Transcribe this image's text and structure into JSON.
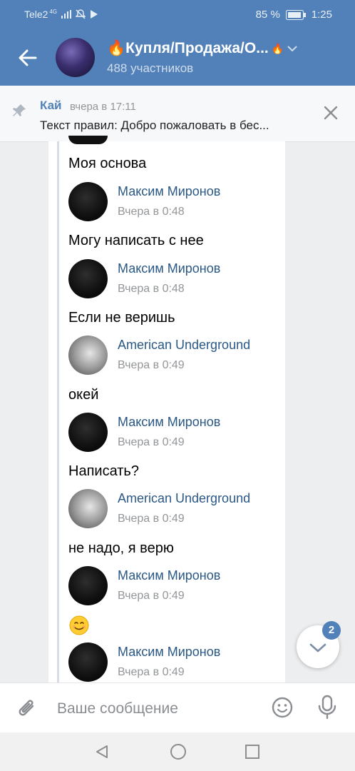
{
  "status_bar": {
    "carrier": "Tele2",
    "network": "4G",
    "battery": "85 %",
    "time": "1:25"
  },
  "header": {
    "title": "🔥Купля/Продажа/О...",
    "title_trailing_emoji": "🔥",
    "subtitle": "488 участников"
  },
  "pinned": {
    "author": "Кай",
    "time": "вчера в 17:11",
    "text": "Текст правил: Добро пожаловать в бес..."
  },
  "messages": [
    {
      "type": "text",
      "text": "Моя основа"
    },
    {
      "type": "sender",
      "name": "Максим Миронов",
      "time": "Вчера в 0:48",
      "avatar": "maxim"
    },
    {
      "type": "text",
      "text": "Могу написать с нее"
    },
    {
      "type": "sender",
      "name": "Максим Миронов",
      "time": "Вчера в 0:48",
      "avatar": "maxim"
    },
    {
      "type": "text",
      "text": "Если не веришь"
    },
    {
      "type": "sender",
      "name": "American Underground",
      "time": "Вчера в 0:49",
      "avatar": "amer"
    },
    {
      "type": "text",
      "text": "окей"
    },
    {
      "type": "sender",
      "name": "Максим Миронов",
      "time": "Вчера в 0:49",
      "avatar": "maxim"
    },
    {
      "type": "text",
      "text": "Написать?"
    },
    {
      "type": "sender",
      "name": "American Underground",
      "time": "Вчера в 0:49",
      "avatar": "amer"
    },
    {
      "type": "text",
      "text": "не надо, я верю"
    },
    {
      "type": "sender",
      "name": "Максим Миронов",
      "time": "Вчера в 0:49",
      "avatar": "maxim"
    },
    {
      "type": "emoji",
      "icon": "smiling-face-emoji"
    },
    {
      "type": "sender",
      "name": "Максим Миронов",
      "time": "Вчера в 0:49",
      "avatar": "maxim"
    }
  ],
  "scroll_down": {
    "badge": "2"
  },
  "composer": {
    "placeholder": "Ваше сообщение"
  },
  "colors": {
    "accent": "#5181b8",
    "name": "#2a5885",
    "muted": "#939699"
  }
}
